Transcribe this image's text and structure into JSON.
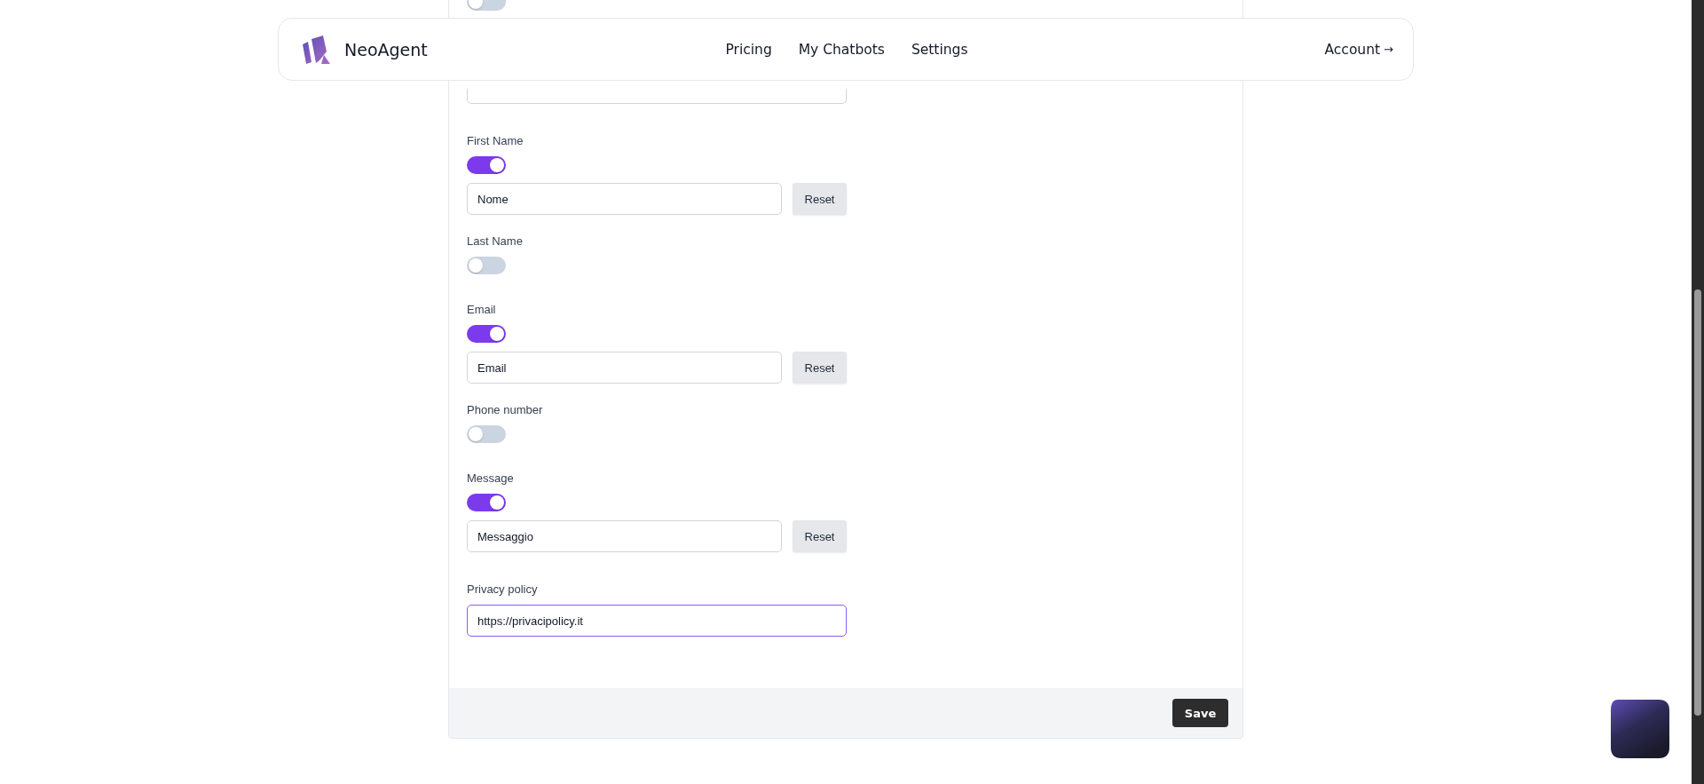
{
  "header": {
    "brand": "NeoAgent",
    "nav": [
      {
        "label": "Pricing"
      },
      {
        "label": "My Chatbots"
      },
      {
        "label": "Settings"
      }
    ],
    "account": "Account",
    "account_arrow": "→"
  },
  "fields": [
    {
      "kind": "toggle",
      "on": false
    },
    {
      "kind": "select"
    },
    {
      "kind": "toggle",
      "label": "First Name",
      "on": true,
      "value": "Nome",
      "reset": "Reset"
    },
    {
      "kind": "toggle",
      "label": "Last Name",
      "on": false
    },
    {
      "kind": "toggle",
      "label": "Email",
      "on": true,
      "value": "Email",
      "reset": "Reset"
    },
    {
      "kind": "toggle",
      "label": "Phone number",
      "on": false
    },
    {
      "kind": "toggle",
      "label": "Message",
      "on": true,
      "value": "Messaggio",
      "reset": "Reset"
    },
    {
      "kind": "text",
      "label": "Privacy policy",
      "value": "https://privacipolicy.it",
      "focused": true
    }
  ],
  "save": "Save"
}
